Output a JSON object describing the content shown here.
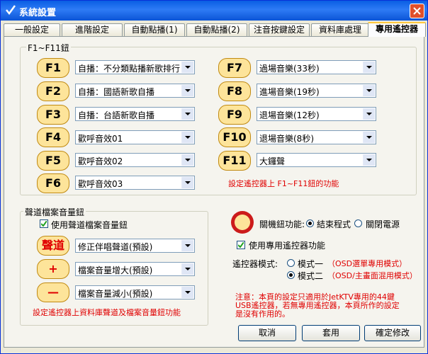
{
  "window": {
    "title": "系統設置"
  },
  "tabs": [
    "一般設定",
    "進階設定",
    "自動點播(1)",
    "自動點播(2)",
    "注音按鍵設定",
    "資料庫處理",
    "專用遙控器"
  ],
  "fgroup": {
    "legend": "F1~F11鈕",
    "left": [
      {
        "key": "F1",
        "value": "自播：不分類點播新歌排行"
      },
      {
        "key": "F2",
        "value": "自播：國語新歌自播"
      },
      {
        "key": "F3",
        "value": "自播：台語新歌自播"
      },
      {
        "key": "F4",
        "value": "歡呼音效01"
      },
      {
        "key": "F5",
        "value": "歡呼音效02"
      },
      {
        "key": "F6",
        "value": "歡呼音效03"
      }
    ],
    "right": [
      {
        "key": "F7",
        "value": "過場音樂(33秒)"
      },
      {
        "key": "F8",
        "value": "進場音樂(19秒)"
      },
      {
        "key": "F9",
        "value": "退場音樂(12秒)"
      },
      {
        "key": "F10",
        "value": "退場音樂(8秒)"
      },
      {
        "key": "F11",
        "value": "大鑼聲"
      }
    ],
    "note": "設定遙控器上 F1~F11鈕的功能"
  },
  "channel": {
    "legend": "聲道檔案音量鈕",
    "use_label": "使用聲道檔案音量鈕",
    "rows": [
      {
        "key": "聲道",
        "value": "修正伴唱聲道(預設)"
      },
      {
        "key": "+",
        "value": "檔案音量增大(預設)"
      },
      {
        "key": "—",
        "value": "檔案音量減小(預設)"
      }
    ],
    "note": "設定遙控器上資料庫聲道及檔案音量鈕功能"
  },
  "power": {
    "label": "關機鈕功能:",
    "opt1": "結束程式",
    "opt2": "關閉電源"
  },
  "remote": {
    "use_label": "使用專用遙控器功能",
    "mode_label": "遙控器模式:",
    "mode1": "模式一",
    "mode1_note": "（OSD選單專用模式）",
    "mode2": "模式二",
    "mode2_note": "（OSD/主畫面混用模式）"
  },
  "warning": [
    "注意：本頁的設定只適用於JetKTV專用的44鍵",
    "USB遙控器，若無專用遙控器，本頁所作的設定",
    "是沒有作用的。"
  ],
  "buttons": {
    "cancel": "取消",
    "apply": "套用",
    "ok": "確定修改"
  },
  "colors": {
    "title_bar": "#0a5ee3",
    "key_fill": "#fde49a",
    "note_red": "#e00000"
  }
}
